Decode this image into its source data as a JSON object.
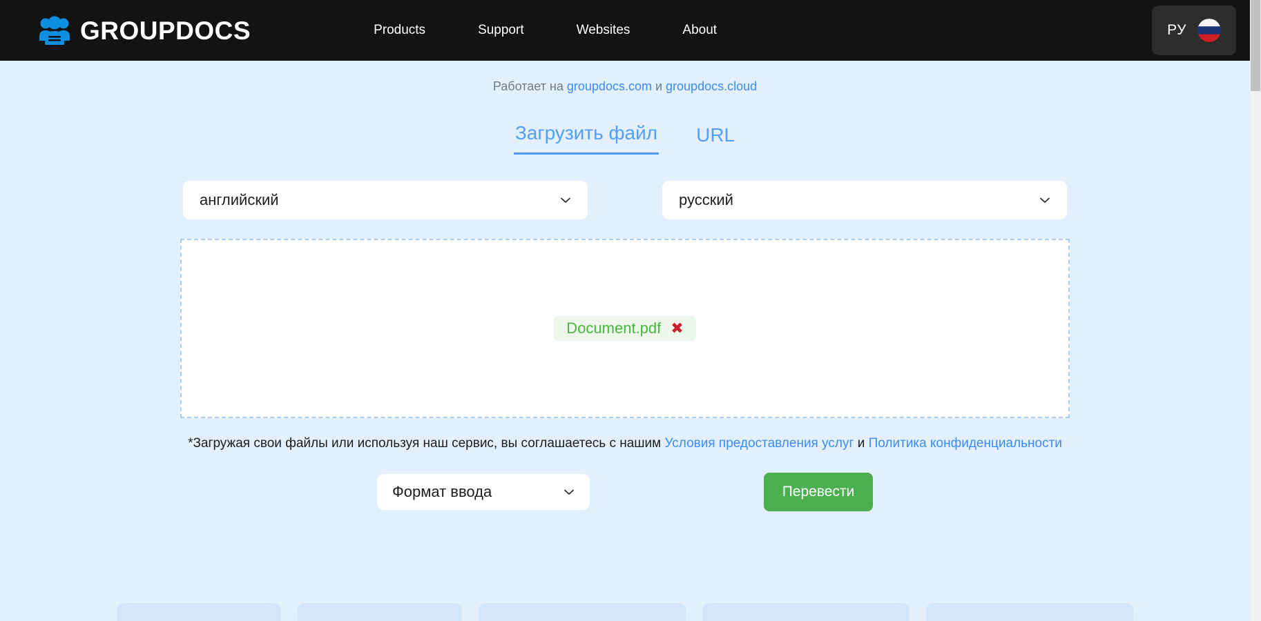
{
  "header": {
    "brand_name": "GROUPDOCS",
    "brand_icon": "group-people-icon",
    "nav": [
      {
        "label": "Products"
      },
      {
        "label": "Support"
      },
      {
        "label": "Websites"
      },
      {
        "label": "About"
      }
    ],
    "language_selector": {
      "code": "РУ",
      "flag": "russia-flag-icon"
    },
    "background_color": "#131313"
  },
  "powered": {
    "prefix": "Работает на ",
    "link1": "groupdocs.com",
    "conjunction": " и ",
    "link2": "groupdocs.cloud"
  },
  "tabs": [
    {
      "label": "Загрузить файл",
      "active": true
    },
    {
      "label": "URL",
      "active": false
    }
  ],
  "source_language": {
    "value": "английский",
    "chevron": "chevron-down-icon"
  },
  "target_language": {
    "value": "русский",
    "chevron": "chevron-down-icon"
  },
  "dropzone": {
    "file_name": "Document.pdf",
    "remove_icon": "close-cross-icon",
    "remove_glyph": "✖"
  },
  "terms": {
    "prefix": "*Загружая свои файлы или используя наш сервис, вы соглашаетесь с нашим ",
    "link1": "Условия предоставления услуг",
    "conjunction": " и ",
    "link2": "Политика конфиденциальности"
  },
  "format_select": {
    "value": "Формат ввода",
    "chevron": "chevron-down-icon"
  },
  "translate_button": {
    "label": "Перевести"
  },
  "colors": {
    "page_background": "#e3f0fc",
    "header_background": "#131313",
    "accent_blue": "#3b8bf5",
    "tab_blue": "#54a0f7",
    "success_green": "#4cb050",
    "file_green": "#4bb543",
    "remove_red": "#cc1f2b",
    "brand_blue": "#0e8fe0"
  },
  "scrollbar": {
    "orientation": "vertical",
    "position": "top"
  }
}
